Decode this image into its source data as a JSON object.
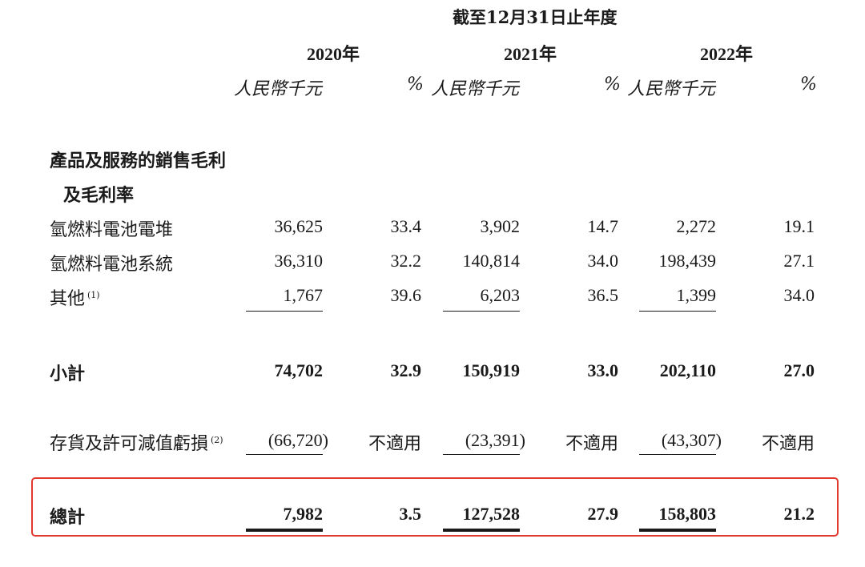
{
  "header": {
    "period": "截至12月31日止年度",
    "years": [
      "2020年",
      "2021年",
      "2022年"
    ],
    "unit_amount": "人民幣千元",
    "unit_pct": "%"
  },
  "section": {
    "title_line1": "產品及服務的銷售毛利",
    "title_line2": "及毛利率"
  },
  "rows": [
    {
      "label": "氫燃料電池電堆",
      "sup": "",
      "values": [
        "36,625",
        "33.4",
        "3,902",
        "14.7",
        "2,272",
        "19.1"
      ]
    },
    {
      "label": "氫燃料電池系統",
      "sup": "",
      "values": [
        "36,310",
        "32.2",
        "140,814",
        "34.0",
        "198,439",
        "27.1"
      ]
    },
    {
      "label": "其他",
      "sup": "(1)",
      "values": [
        "1,767",
        "39.6",
        "6,203",
        "36.5",
        "1,399",
        "34.0"
      ]
    }
  ],
  "subtotal": {
    "label": "小計",
    "values": [
      "74,702",
      "32.9",
      "150,919",
      "33.0",
      "202,110",
      "27.0"
    ]
  },
  "impairment": {
    "label": "存貨及許可減值虧損",
    "sup": "(2)",
    "values": [
      "(66,720)",
      "不適用",
      "(23,391)",
      "不適用",
      "(43,307)",
      "不適用"
    ]
  },
  "total": {
    "label": "總計",
    "values": [
      "7,982",
      "3.5",
      "127,528",
      "27.9",
      "158,803",
      "21.2"
    ]
  },
  "highlight_color": "#e03a2f"
}
